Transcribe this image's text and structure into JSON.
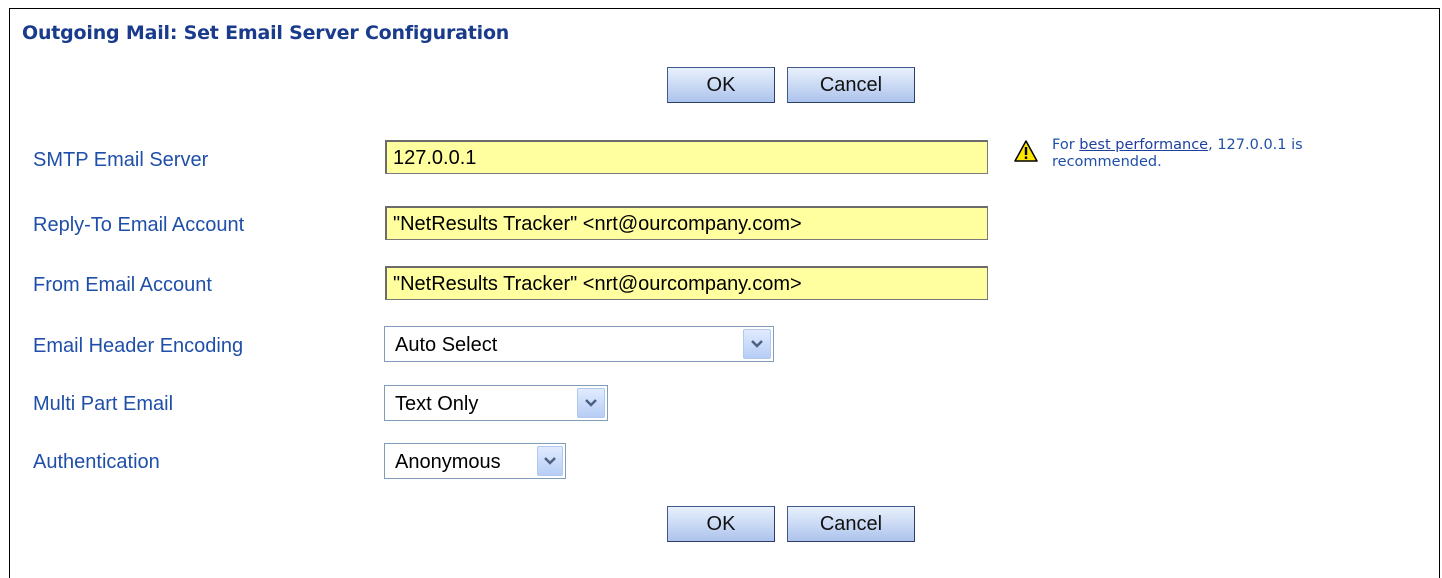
{
  "header": {
    "title": "Outgoing Mail: Set Email Server Configuration"
  },
  "buttons": {
    "ok_label": "OK",
    "cancel_label": "Cancel"
  },
  "fields": {
    "smtp_server": {
      "label": "SMTP Email Server",
      "value": "127.0.0.1"
    },
    "reply_to": {
      "label": "Reply-To Email Account",
      "value": "\"NetResults Tracker\" <nrt@ourcompany.com>"
    },
    "from": {
      "label": "From Email Account",
      "value": "\"NetResults Tracker\" <nrt@ourcompany.com>"
    },
    "header_encoding": {
      "label": "Email Header Encoding",
      "selected": "Auto Select"
    },
    "multipart": {
      "label": "Multi Part Email",
      "selected": "Text Only"
    },
    "authentication": {
      "label": "Authentication",
      "selected": "Anonymous"
    }
  },
  "notice": {
    "icon": "warning-icon",
    "prefix": "For ",
    "link_text": "best performance",
    "suffix": ", 127.0.0.1 is",
    "line2": "recommended."
  },
  "colors": {
    "title": "#1a3b8c",
    "label": "#1f4fa8",
    "field_bg": "#ffffa0"
  }
}
